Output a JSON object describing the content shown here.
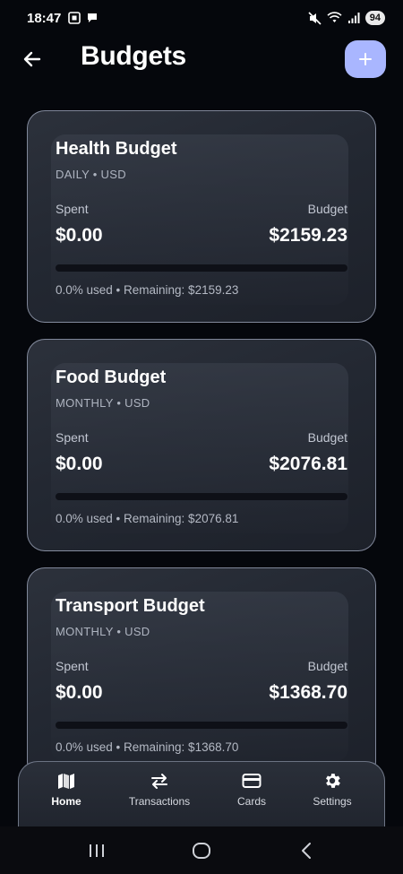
{
  "status_bar": {
    "time": "18:47",
    "battery": "94"
  },
  "header": {
    "title": "Budgets",
    "back_icon": "arrow-left-icon",
    "add_icon": "plus-icon"
  },
  "colors": {
    "background": "#05070c",
    "card": "#252a33",
    "accent": "#a9b6ff",
    "progress_track": "#0e1017"
  },
  "budgets": [
    {
      "name": "Health Budget",
      "meta": "DAILY • USD",
      "spent_label": "Spent",
      "budget_label": "Budget",
      "spent": "$0.00",
      "budget": "$2159.23",
      "progress_percent": 0,
      "footer": "0.0% used • Remaining: $2159.23"
    },
    {
      "name": "Food Budget",
      "meta": "MONTHLY • USD",
      "spent_label": "Spent",
      "budget_label": "Budget",
      "spent": "$0.00",
      "budget": "$2076.81",
      "progress_percent": 0,
      "footer": "0.0% used • Remaining: $2076.81"
    },
    {
      "name": "Transport Budget",
      "meta": "MONTHLY • USD",
      "spent_label": "Spent",
      "budget_label": "Budget",
      "spent": "$0.00",
      "budget": "$1368.70",
      "progress_percent": 0,
      "footer": "0.0% used • Remaining: $1368.70"
    }
  ],
  "bottom_nav": {
    "items": [
      {
        "label": "Home",
        "icon": "home-icon",
        "active": true
      },
      {
        "label": "Transactions",
        "icon": "swap-arrows-icon",
        "active": false
      },
      {
        "label": "Cards",
        "icon": "credit-card-icon",
        "active": false
      },
      {
        "label": "Settings",
        "icon": "gear-icon",
        "active": false
      }
    ]
  }
}
